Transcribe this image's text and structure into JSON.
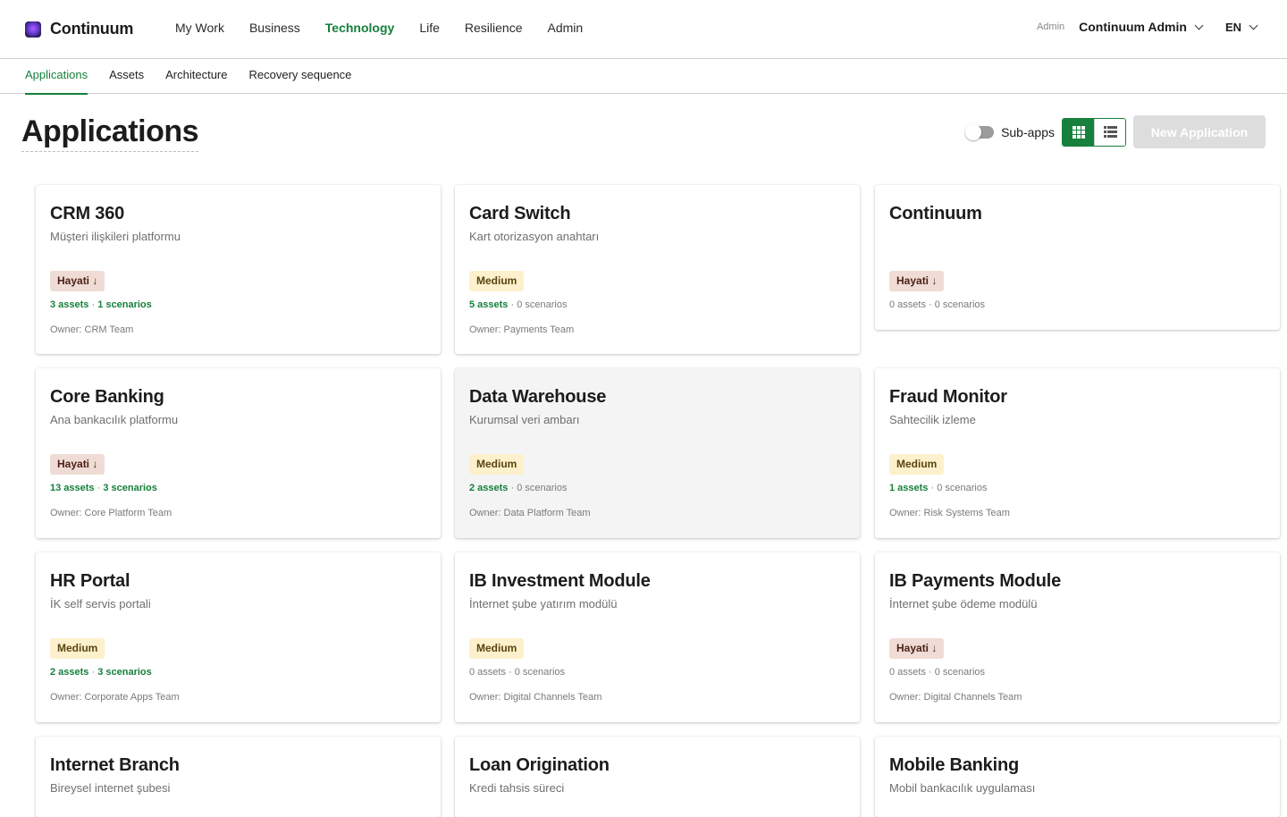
{
  "header": {
    "brand": "Continuum",
    "nav": [
      {
        "label": "My Work",
        "active": false
      },
      {
        "label": "Business",
        "active": false
      },
      {
        "label": "Technology",
        "active": true
      },
      {
        "label": "Life",
        "active": false
      },
      {
        "label": "Resilience",
        "active": false
      },
      {
        "label": "Admin",
        "active": false
      }
    ],
    "role": "Admin",
    "user": "Continuum Admin",
    "lang": "EN"
  },
  "subnav": {
    "tabs": [
      {
        "label": "Applications",
        "active": true
      },
      {
        "label": "Assets",
        "active": false
      },
      {
        "label": "Architecture",
        "active": false
      },
      {
        "label": "Recovery sequence",
        "active": false
      }
    ]
  },
  "page": {
    "title": "Applications",
    "subapps_label": "Sub-apps",
    "new_button": "New Application"
  },
  "colors": {
    "accent": "#16803c",
    "critical_badge_bg": "#f0dcd6",
    "medium_badge_bg": "#fcf1cc"
  },
  "cards": [
    {
      "name": "CRM 360",
      "desc": "Müşteri ilişkileri platformu",
      "badge": "Hayati ↓",
      "level": "crit",
      "assets": "3 assets",
      "scenarios": "1 scenarios",
      "owner": "Owner: CRM Team"
    },
    {
      "name": "Card Switch",
      "desc": "Kart otorizasyon anahtarı",
      "badge": "Medium",
      "level": "med",
      "assets": "5 assets",
      "scenarios": "0 scenarios",
      "owner": "Owner: Payments Team"
    },
    {
      "name": "Continuum",
      "desc": "",
      "badge": "Hayati ↓",
      "level": "crit",
      "assets": "0 assets",
      "scenarios": "0 scenarios",
      "owner": ""
    },
    {
      "name": "Core Banking",
      "desc": "Ana bankacılık platformu",
      "badge": "Hayati ↓",
      "level": "crit",
      "assets": "13 assets",
      "scenarios": "3 scenarios",
      "owner": "Owner: Core Platform Team"
    },
    {
      "name": "Data Warehouse",
      "desc": "Kurumsal veri ambarı",
      "badge": "Medium",
      "level": "med",
      "assets": "2 assets",
      "scenarios": "0 scenarios",
      "owner": "Owner: Data Platform Team"
    },
    {
      "name": "Fraud Monitor",
      "desc": "Sahtecilik izleme",
      "badge": "Medium",
      "level": "med",
      "assets": "1 assets",
      "scenarios": "0 scenarios",
      "owner": "Owner: Risk Systems Team"
    },
    {
      "name": "HR Portal",
      "desc": "İK self servis portali",
      "badge": "Medium",
      "level": "med",
      "assets": "2 assets",
      "scenarios": "3 scenarios",
      "owner": "Owner: Corporate Apps Team"
    },
    {
      "name": "IB Investment Module",
      "desc": "İnternet şube yatırım modülü",
      "badge": "Medium",
      "level": "med",
      "assets": "0 assets",
      "scenarios": "0 scenarios",
      "owner": "Owner: Digital Channels Team"
    },
    {
      "name": "IB Payments Module",
      "desc": "İnternet şube ödeme modülü",
      "badge": "Hayati ↓",
      "level": "crit",
      "assets": "0 assets",
      "scenarios": "0 scenarios",
      "owner": "Owner: Digital Channels Team"
    },
    {
      "name": "Internet Branch",
      "desc": "Bireysel internet şubesi",
      "badge": "",
      "level": "",
      "assets": "",
      "scenarios": "",
      "owner": ""
    },
    {
      "name": "Loan Origination",
      "desc": "Kredi tahsis süreci",
      "badge": "",
      "level": "",
      "assets": "",
      "scenarios": "",
      "owner": ""
    },
    {
      "name": "Mobile Banking",
      "desc": "Mobil bankacılık uygulaması",
      "badge": "",
      "level": "",
      "assets": "",
      "scenarios": "",
      "owner": ""
    }
  ]
}
